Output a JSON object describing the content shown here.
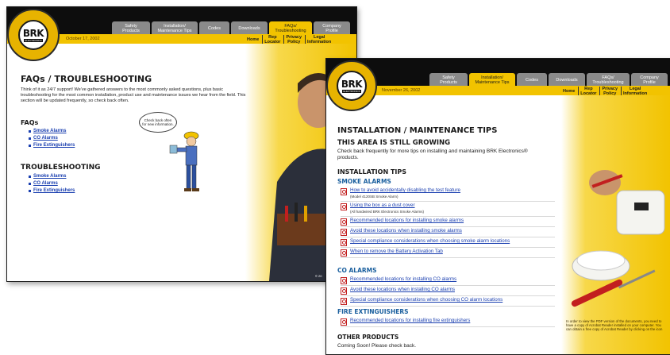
{
  "window1": {
    "date": "October 17, 2002",
    "logo": {
      "text": "BRK",
      "sub": "ELECTRONICS",
      "ring": "DESIGNED WITH CONTRACTORS IN MIND"
    },
    "tabs": [
      {
        "label": "Safety\nProducts",
        "active": false
      },
      {
        "label": "Installation/\nMaintenance Tips",
        "active": false
      },
      {
        "label": "Codes",
        "active": false
      },
      {
        "label": "Downloads",
        "active": false
      },
      {
        "label": "FAQs/\nTroubleshooting",
        "active": true
      },
      {
        "label": "Company\nProfile",
        "active": false
      }
    ],
    "links": [
      "Home",
      "Rep\nLocator",
      "Privacy\nPolicy",
      "Legal\nInformation"
    ],
    "title": "FAQs / TROUBLESHOOTING",
    "intro": "Think of it as 24/7 support! We've gathered answers to the most commonly asked questions, plus basic troubleshooting for the most common installation, product use and maintenance issues we hear from the field. This section will be updated frequently, so check back often.",
    "faqs": {
      "heading": "FAQs",
      "items": [
        "Smoke Alarms",
        "CO Alarms",
        "Fire Extinguishers"
      ]
    },
    "troubleshooting": {
      "heading": "TROUBLESHOOTING",
      "items": [
        "Smoke Alarms",
        "CO Alarms",
        "Fire Extinguishers"
      ]
    },
    "bubble": "Check back often\nfor new information.",
    "copyright": "© 20"
  },
  "window2": {
    "date": "November 26, 2002",
    "logo": {
      "text": "BRK",
      "sub": "ELECTRONICS",
      "ring": "DESIGNED WITH CONTRACTORS IN MIND"
    },
    "tabs": [
      {
        "label": "Safety\nProducts",
        "active": false
      },
      {
        "label": "Installation/\nMaintenance Tips",
        "active": true
      },
      {
        "label": "Codes",
        "active": false
      },
      {
        "label": "Downloads",
        "active": false
      },
      {
        "label": "FAQs/\nTroubleshooting",
        "active": false
      },
      {
        "label": "Company\nProfile",
        "active": false
      }
    ],
    "links": [
      "Home",
      "Rep\nLocator",
      "Privacy\nPolicy",
      "Legal\nInformation"
    ],
    "title": "INSTALLATION / MAINTENANCE TIPS",
    "growing_heading": "THIS AREA IS STILL GROWING",
    "growing_text": "Check back frequently for more tips on installing and maintaining BRK Electronics® products.",
    "tips_heading": "INSTALLATION TIPS",
    "smoke": {
      "heading": "SMOKE ALARMS",
      "items": [
        {
          "label": "How to avoid accidentally disabling the test feature",
          "note": "(Model 4120SB Smoke Alarm)"
        },
        {
          "label": "Using the box as a dust cover",
          "note": "(All hardwired BRK Electronics Smoke Alarms)"
        },
        {
          "label": "Recommended locations for installing smoke alarms",
          "note": ""
        },
        {
          "label": "Avoid these locations when installing smoke alarms",
          "note": ""
        },
        {
          "label": "Special compliance considerations when choosing smoke alarm locations",
          "note": ""
        },
        {
          "label": "When to remove the Battery Activation Tab",
          "note": ""
        }
      ]
    },
    "co": {
      "heading": "CO ALARMS",
      "items": [
        {
          "label": "Recommended locations for installing CO alarms"
        },
        {
          "label": "Avoid these locations when installing CO alarms"
        },
        {
          "label": "Special compliance considerations when choosing CO alarm locations"
        }
      ]
    },
    "fire": {
      "heading": "FIRE EXTINGUISHERS",
      "items": [
        {
          "label": "Recommended locations for installing fire extinguishers"
        }
      ]
    },
    "other": {
      "heading": "OTHER PRODUCTS",
      "text": "Coming Soon! Please check back."
    },
    "pdf_note": "In order to view the PDF version of the documents, you need to have a copy of Acrobat Reader installed on your computer. You can obtain a free copy of Acrobat Reader by clicking on the icon"
  },
  "colors": {
    "brand_yellow": "#f2c300",
    "bar_black": "#0d0d0d",
    "link_blue": "#1a3fb0"
  }
}
